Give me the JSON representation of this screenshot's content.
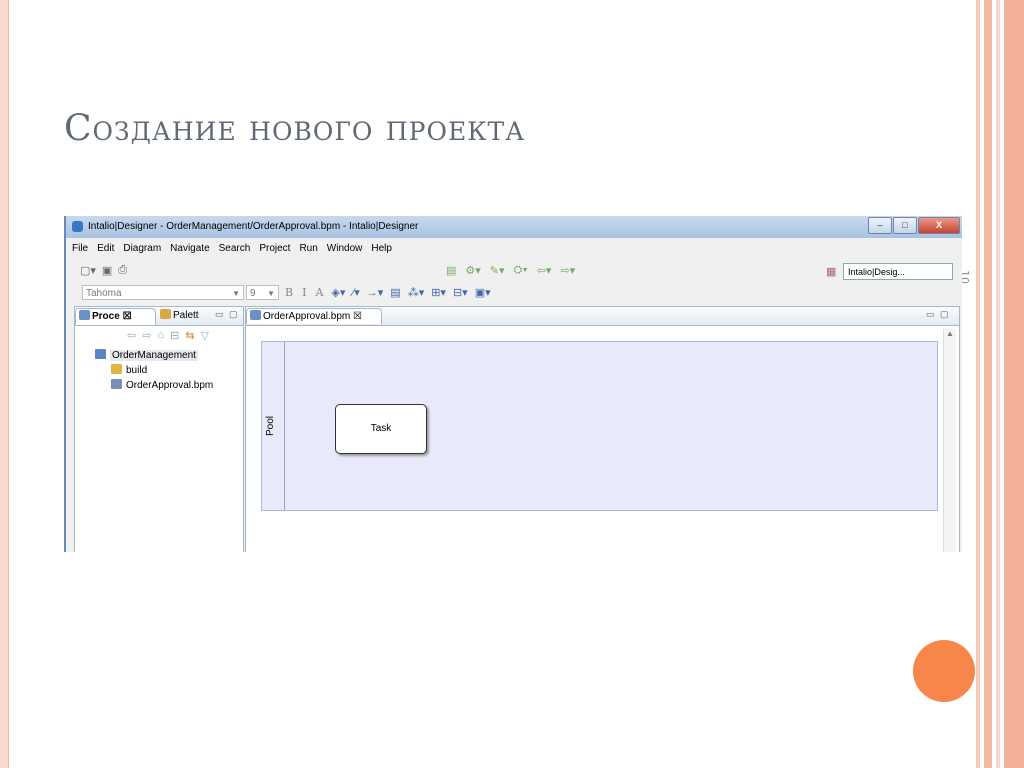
{
  "slide": {
    "title": "Создание нового проекта",
    "page_number": "10",
    "accent_color": "#f8864a"
  },
  "window": {
    "title": "Intalio|Designer - OrderManagement/OrderApproval.bpm - Intalio|Designer",
    "buttons": {
      "minimize": "–",
      "maximize": "□",
      "close": "X"
    }
  },
  "menu": {
    "items": [
      "File",
      "Edit",
      "Diagram",
      "Navigate",
      "Search",
      "Project",
      "Run",
      "Window",
      "Help"
    ]
  },
  "toolbar": {
    "perspective_label": "Intalio|Desig...",
    "font_value": "Tahoma",
    "size_value": "9",
    "format_buttons": [
      "B",
      "I",
      "A"
    ]
  },
  "left_panel": {
    "tabs": [
      "Proce",
      "Palett"
    ],
    "tree": {
      "project": "OrderManagement",
      "children": [
        "build",
        "OrderApproval.bpm"
      ]
    }
  },
  "editor": {
    "tab_label": "OrderApproval.bpm",
    "pool_label": "Pool",
    "task_label": "Task"
  }
}
